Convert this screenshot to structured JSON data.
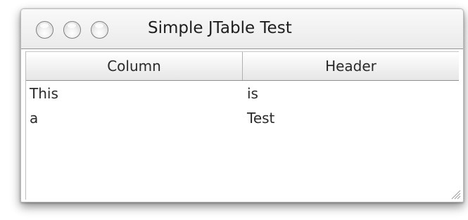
{
  "window": {
    "title": "Simple JTable Test",
    "buttons": [
      {
        "name": "close",
        "icon": "window-close-icon"
      },
      {
        "name": "minimize",
        "icon": "window-minimize-icon"
      },
      {
        "name": "zoom",
        "icon": "window-zoom-icon"
      }
    ]
  },
  "table": {
    "columns": [
      "Column",
      "Header"
    ],
    "rows": [
      [
        "This",
        "is"
      ],
      [
        "a",
        "Test"
      ]
    ]
  },
  "colors": {
    "traffic_light_style": "graphite",
    "text": "#2a2a2a"
  },
  "icons": {
    "resize_grip": "resize-grip-icon"
  }
}
